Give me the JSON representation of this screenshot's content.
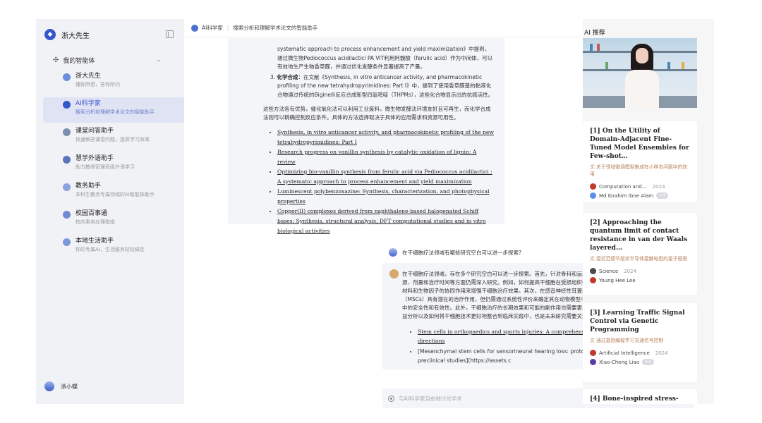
{
  "brand": {
    "name": "浙大先生"
  },
  "sidebar": {
    "section_label": "我的智能体",
    "items": [
      {
        "title": "浙大先生",
        "subtitle": "懂你所想，答你所问",
        "color": "#6d8ee0"
      },
      {
        "title": "AI科学家",
        "subtitle": "搜索分析和理解学术论文的智能助手",
        "color": "#3457c9",
        "active": true
      },
      {
        "title": "课堂问答助手",
        "subtitle": "快速解答课堂问题，提高学习效率",
        "color": "#7a8fb0"
      },
      {
        "title": "慧学外语助手",
        "subtitle": "助力教师管理班级外语学习",
        "color": "#5c74b8"
      },
      {
        "title": "教务助手",
        "subtitle": "本科生教务专属领域的AI智能体助手",
        "color": "#8aa2e0"
      },
      {
        "title": "校园百事通",
        "subtitle": "校内事务办理指南",
        "color": "#6f8bd4"
      },
      {
        "title": "本地生活助手",
        "subtitle": "你的专属AI，生活服务轻松搞定",
        "color": "#7b98d8"
      }
    ],
    "user": "浙小螺"
  },
  "header": {
    "agent": "AI科学家",
    "desc": "搜索分析和理解学术论文的智能助手"
  },
  "chat": {
    "ol_items": [
      {
        "text": "systematic approach to process enhancement and yield maximization》中提到，通过微生物Pediococcus acidilactici PA VIT利用阿魏酸（ferulic acid）作为中间体，可以有效地生产生物香草醛，并通过优化发酵条件显著提高了产量。"
      },
      {
        "num": "3.",
        "label": "化学合成",
        "text": "：在文献《Synthesis, in vitro anticancer activity, and pharmacokinetic profiling of the new tetrahydropyrimidines: Part I》中，提到了使用香草醛基的黏液化合物通过传统的Biginelli反应合成新型四氢嘧啶（THPMs），这些化合物显示出的抗癌活性。"
      }
    ],
    "summary": "这些方法各有优势，催化氧化法可以利用工业废料，微生物发酵法环境友好且可再生，而化学合成法则可以精确控制反应条件。具体的方法选择取决于具体的应用需求和资源可用性。",
    "refs": [
      "Synthesis, in vitro anticancer activity, and pharmacokinetic profiling of the new tetrahydropyrimidines: Part I",
      "Research progress on vanillin synthesis by catalytic oxidation of lignin: A review",
      "Optimizing bio-vanillin synthesis from ferulic acid via Pediococcus acidilactici : A systematic approach to process enhancement and yield maximization",
      "Luminescent polybenzoxazine: Synthesis, characterization, and photophysical properties",
      "Copper(II) complexes derived from naphthalene-based halogenated Schiff bases: Synthesis, structural analysis, DFT computational studies and in vitro biological activities"
    ],
    "question": "在干细胞疗法领域有哪些研究空白可以进一步探索?",
    "answer": "在干细胞疗法领域，存在多个研究空白可以进一步探索。首先，针对骨科和运动损伤，干细胞治疗的机制、最佳细胞来源、剂量和治疗时间等方面仍需深入研究。例如，如何提高干细胞在受损组织中的存活率和分化效率，以及如何通过生物材料和生物因子的协同作用来增强干细胞治疗效果。其次，在感音神经性耳聋治疗中，尽管已有研究表明间充质干细胞（MSCs）具有潜在的治疗作用，但仍需通过系统性评价来确定其在动物模型中的疗效，并进一步探索其在人类临床试验中的安全性和有效性。此外，干细胞治疗的长期效果和可能的副作用也需要更多的研究来评估。最后，伦理问题、成本效益分析以及如何将干细胞技术更好地整合到临床实践中，也是未来研究需要关注的重要方向。",
    "refs2": [
      "Stem cells in orthopaedics and sports injuries: A comprehensive review and future research directions",
      "[Mesenchymal stem cells for sensorineural hearing loss: protocol for a systematic review of preclinical studies](https://assets.c"
    ],
    "input_placeholder": "与AI科学家自由地讨论学术"
  },
  "right": {
    "title": "AI 推荐",
    "cards": [
      {
        "title": "[1] On the Utility of Domain-Adjacent Fine-Tuned Model Ensembles for Few-shot…",
        "summary": "关于领域微调模型集成在小样本问题中的效用",
        "venue": "Computation and…",
        "year": "2024",
        "author": "Md Ibrahim Ibne Alam",
        "more": "+4",
        "venue_color": "#c0392b",
        "author_color": "#5b8def"
      },
      {
        "title": "[2] Approaching the quantum limit of contact resistance in van der Waals layered…",
        "summary": "接近范德华层状半导体接触电阻的量子极限",
        "venue": "Science",
        "year": "2024",
        "author": "Young Hee Lee",
        "more": "",
        "venue_color": "#4a4a4a",
        "author_color": "#c0392b"
      },
      {
        "title": "[3] Learning Traffic Signal Control via Genetic Programming",
        "summary": "通过基因编程学习交通信号控制",
        "venue": "Artificial Intelligence",
        "year": "2024",
        "author": "Xiao-Cheng Liao",
        "more": "+2",
        "venue_color": "#c0392b",
        "author_color": "#5a3aa8"
      },
      {
        "title": "[4] Bone-inspired stress-"
      }
    ]
  }
}
